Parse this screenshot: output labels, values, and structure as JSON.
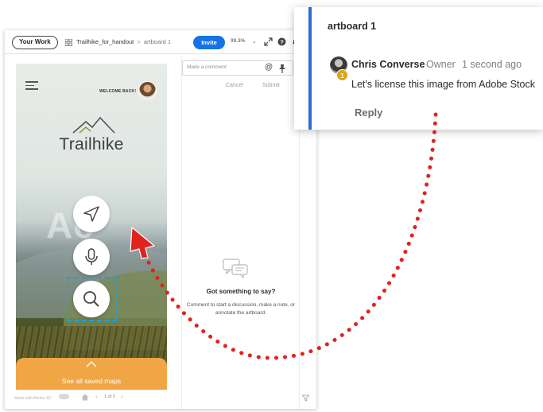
{
  "topbar": {
    "your_work_label": "Your Work",
    "doc_name": "Trailhike_for_handout",
    "separator": ">",
    "artboard_crumb": "artboard 1",
    "invite_label": "Invite",
    "zoom_level": "99.3%",
    "zoom_chevron": "⌄",
    "icons": [
      "grid-icon",
      "fullscreen-icon",
      "help-icon",
      "bell-icon"
    ]
  },
  "artboard": {
    "welcome_text": "WELCOME BACK!",
    "brand_name": "Trailhike",
    "watermark_text": "Ac",
    "fab_icons": [
      "navigate-icon",
      "microphone-icon",
      "search-icon"
    ],
    "saved_maps_label": "See all saved maps",
    "brand_color": "#f1a645"
  },
  "comment_panel": {
    "input_placeholder": "Make a comment",
    "at_symbol": "@",
    "cancel_label": "Cancel",
    "submit_label": "Submit",
    "empty_title": "Got something to say?",
    "empty_text": "Comment to start a discussion, make a note, or annotate the artboard."
  },
  "footer": {
    "made_with": "Made with Adobe XD",
    "prev": "‹",
    "pages": "1 of 3",
    "next": "›"
  },
  "callout": {
    "title": "artboard 1",
    "badge_number": "1",
    "commenter_name": "Chris Converse",
    "commenter_role": "Owner",
    "timestamp": "1 second ago",
    "comment_text": "Let's license this image from Adobe Stock",
    "reply_label": "Reply",
    "accent_color": "#2c6bd6"
  },
  "annotation": {
    "arrow_color": "#e0231c",
    "selection_color": "#1aa3d9"
  }
}
